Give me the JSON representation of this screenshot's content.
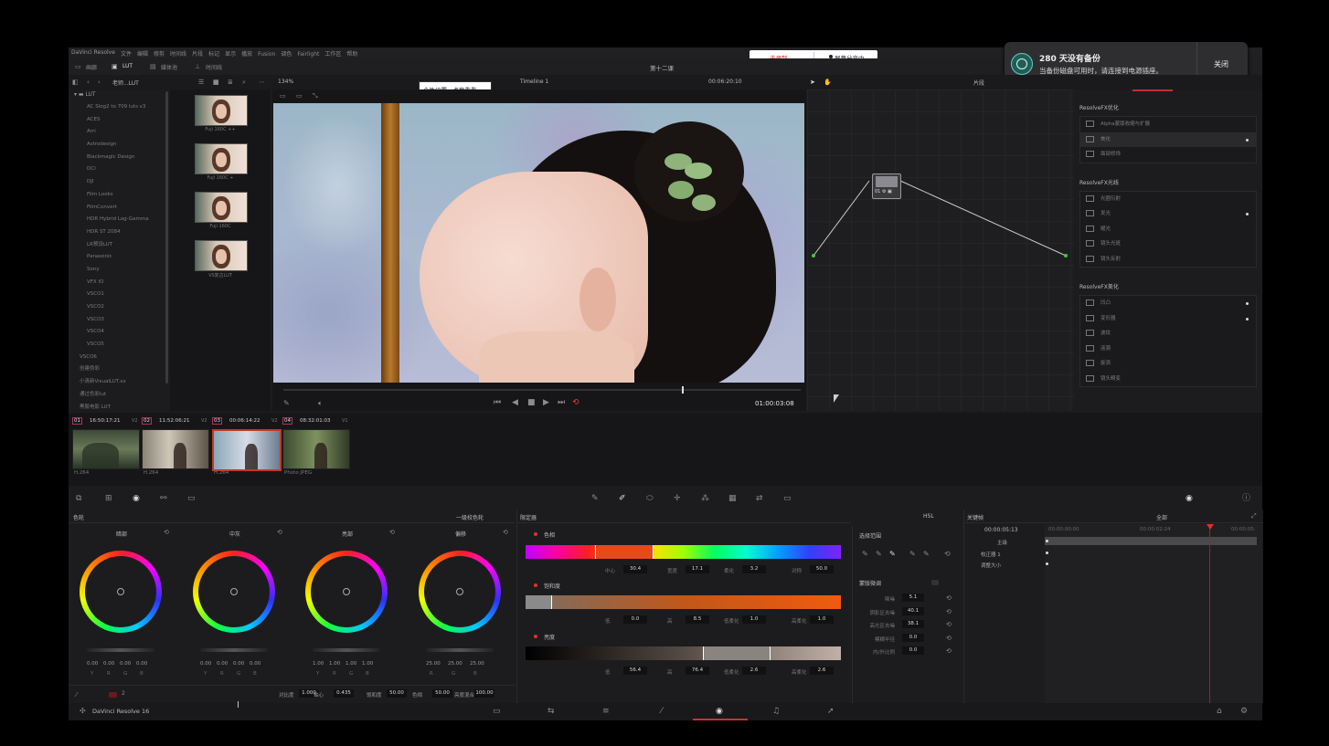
{
  "app": {
    "title": "DaVinci Resolve",
    "menu": [
      "文件",
      "编辑",
      "修剪",
      "时间线",
      "片段",
      "标记",
      "显示",
      "播放",
      "Fusion",
      "调色",
      "Fairlight",
      "工作区",
      "帮助"
    ],
    "project_name": "第十二课",
    "bottom_label": "DaVinci Resolve 16"
  },
  "record": {
    "not_recording": "未录制",
    "sharing": "屏幕分享中"
  },
  "notification": {
    "title": "280 天没有备份",
    "body": "当备份磁盘可用时，请连接到电源插座。",
    "close": "关闭"
  },
  "toolbar": {
    "gallery": "画廊",
    "lut": "LUT",
    "media_pool": "媒体池",
    "timeline_btn": "时间线",
    "lut_path": "老师...LUT",
    "zoom": "134%",
    "timeline": "Timeline 1",
    "timecode": "00:06:20:10",
    "mode": "片段",
    "tooltip": "个性设置，点我看看"
  },
  "lut_list": {
    "root": "LUT",
    "items": [
      "AC Slog2 to 709 luts v3",
      "ACES",
      "Arri",
      "Astrodesign",
      "Blackmagic Design",
      "DCI",
      "DJI",
      "Film Looks",
      "FilmConvert",
      "HDR Hybrid Log-Gamma",
      "HDR ST 2084",
      "LR预设LUT",
      "Panasonic",
      "Sony",
      "VFX IO",
      "VSCO1",
      "VSCO2",
      "VSCO3",
      "VSCO4",
      "VSCO5",
      "VSCO6",
      "创建伪彩",
      "小清新VisualLUT.xx",
      "通过色彩lut",
      "黑胶电影 LUT"
    ]
  },
  "lut_thumbs": [
    "Fuji 160C ++",
    "Fuji 160C +",
    "Fuji 160C",
    "VS复古LUT"
  ],
  "viewer": {
    "timecode": "01:00:03:08"
  },
  "fx_panel": {
    "sections": [
      {
        "title": "ResolveFX优化",
        "items": [
          "Alpha蒙版收缩与扩展",
          "美化",
          "面部修饰"
        ],
        "selected": 1
      },
      {
        "title": "ResolveFX光线",
        "items": [
          "光圈衍射",
          "发光",
          "耀光",
          "镜头光斑",
          "镜头反射"
        ]
      },
      {
        "title": "ResolveFX美化",
        "items": [
          "凹凸",
          "变形器",
          "波纹",
          "涟漪",
          "旋涡",
          "镜头畸变"
        ]
      }
    ]
  },
  "clips": [
    {
      "num": "01",
      "tc": "16:50:17:21",
      "track": "V2",
      "codec": "H.264"
    },
    {
      "num": "02",
      "tc": "11:52:06:21",
      "track": "V2",
      "codec": "H.264"
    },
    {
      "num": "03",
      "tc": "00:06:14:22",
      "track": "V2",
      "codec": "H.264"
    },
    {
      "num": "04",
      "tc": "08:32:01:03",
      "track": "V1",
      "codec": "Photo JPEG"
    }
  ],
  "color_wheels": {
    "title": "色轮",
    "mode": "一级校色轮",
    "wheels": [
      {
        "name": "暗部",
        "vals": [
          "0.00",
          "0.00",
          "0.00",
          "0.00"
        ]
      },
      {
        "name": "中灰",
        "vals": [
          "0.00",
          "0.00",
          "0.00",
          "0.00"
        ]
      },
      {
        "name": "亮部",
        "vals": [
          "1.00",
          "1.00",
          "1.00",
          "1.00"
        ]
      },
      {
        "name": "偏移",
        "vals": [
          "25.00",
          "25.00",
          "25.00"
        ]
      }
    ],
    "channels": [
      "Y",
      "R",
      "G",
      "B"
    ],
    "page": "2",
    "bottom": [
      {
        "label": "对比度",
        "val": "1.000"
      },
      {
        "label": "轴心",
        "val": "0.435"
      },
      {
        "label": "饱和度",
        "val": "50.00"
      },
      {
        "label": "色相",
        "val": "50.00"
      },
      {
        "label": "亮度混合",
        "val": "100.00"
      }
    ]
  },
  "qualifier": {
    "title": "限定器",
    "mode": "HSL",
    "hue": {
      "label": "色相",
      "fields": [
        [
          "中心",
          "30.4"
        ],
        [
          "宽度",
          "17.1"
        ],
        [
          "柔化",
          "3.2"
        ],
        [
          "对称",
          "50.0"
        ]
      ]
    },
    "sat": {
      "label": "饱和度",
      "fields": [
        [
          "低",
          "0.0"
        ],
        [
          "高",
          "8.5"
        ],
        [
          "低柔化",
          "1.0"
        ],
        [
          "高柔化",
          "1.0"
        ]
      ]
    },
    "lum": {
      "label": "亮度",
      "fields": [
        [
          "低",
          "56.4"
        ],
        [
          "高",
          "76.4"
        ],
        [
          "低柔化",
          "2.6"
        ],
        [
          "高柔化",
          "2.6"
        ]
      ]
    }
  },
  "selection": {
    "title": "选择范围",
    "matte": "蒙版微调",
    "fields": [
      [
        "降噪",
        "5.1"
      ],
      [
        "阴影区去噪",
        "40.1"
      ],
      [
        "高光区去噪",
        "38.1"
      ],
      [
        "模糊半径",
        "0.0"
      ],
      [
        "内/外比例",
        "0.0"
      ]
    ]
  },
  "keyframes": {
    "title": "关键帧",
    "all": "全部",
    "tc": "00:00:05:13",
    "ruler": [
      "00:00:00:00",
      "00:00:02:24",
      "00:00:05:"
    ],
    "rows": [
      "主级",
      "校正器 1",
      "调整大小"
    ]
  }
}
